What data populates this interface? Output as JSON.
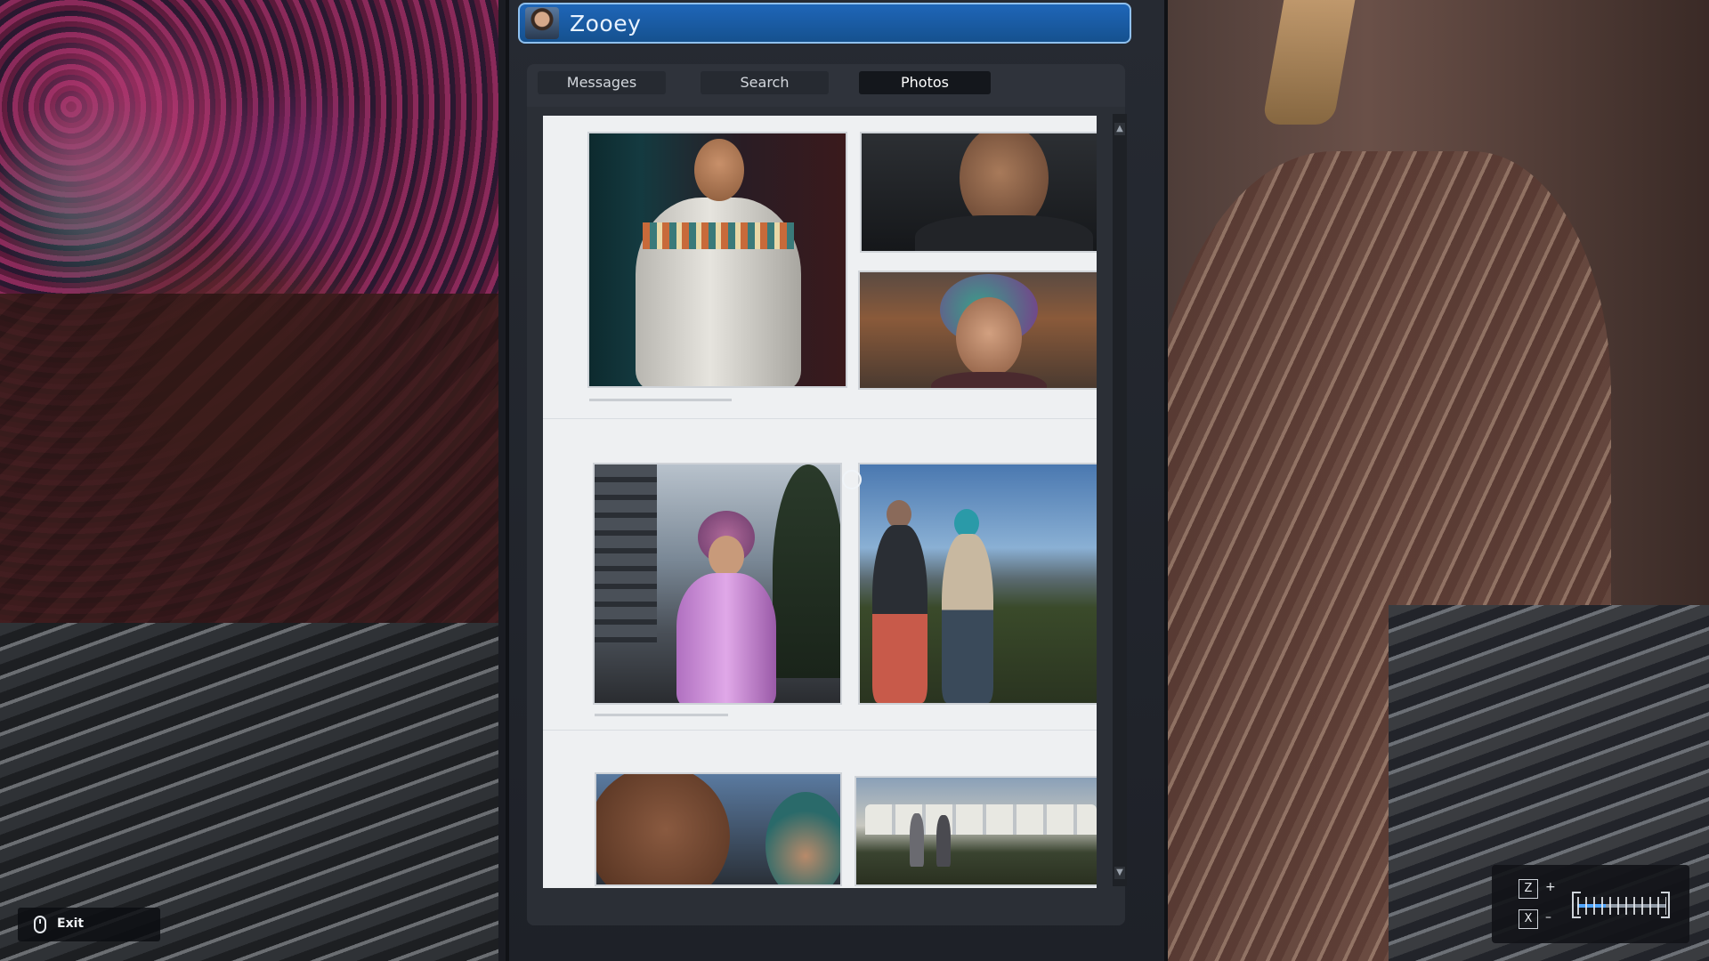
{
  "contact": {
    "name": "Zooey"
  },
  "tabs": [
    {
      "label": "Messages",
      "active": false
    },
    {
      "label": "Search",
      "active": false
    },
    {
      "label": "Photos",
      "active": true
    }
  ],
  "photos": [
    {
      "subject": "man-in-hoodie"
    },
    {
      "subject": "man-closeup"
    },
    {
      "subject": "zooey-portrait"
    },
    {
      "subject": "zooey-city-street"
    },
    {
      "subject": "couple-by-lake"
    },
    {
      "subject": "selfie-closeup"
    },
    {
      "subject": "crowd-tents"
    }
  ],
  "exit": {
    "label": "Exit",
    "icon": "mouse-icon"
  },
  "zoom": {
    "in_key": "Z",
    "out_key": "X",
    "in_sign": "+",
    "out_sign": "–",
    "level": 0.32
  },
  "colors": {
    "header": "#1f66b8",
    "accent": "#4ea4ff"
  }
}
